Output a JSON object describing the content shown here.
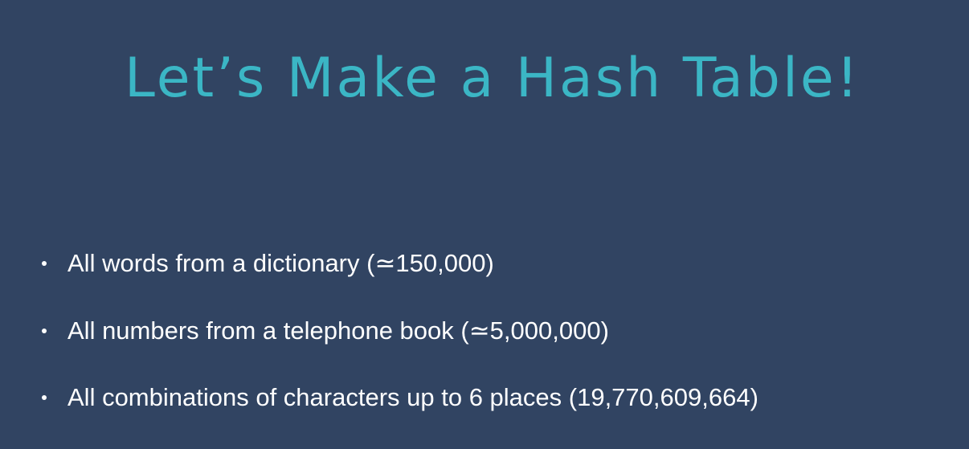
{
  "slide": {
    "title": "Let’s Make a Hash Table!",
    "bullets": [
      "All words from a dictionary (≃150,000)",
      "All numbers from a telephone book (≃5,000,000)",
      "All combinations of characters up to 6 places (19,770,609,664)"
    ],
    "colors": {
      "background": "#314462",
      "title": "#3bb6c5",
      "text": "#ffffff"
    }
  }
}
